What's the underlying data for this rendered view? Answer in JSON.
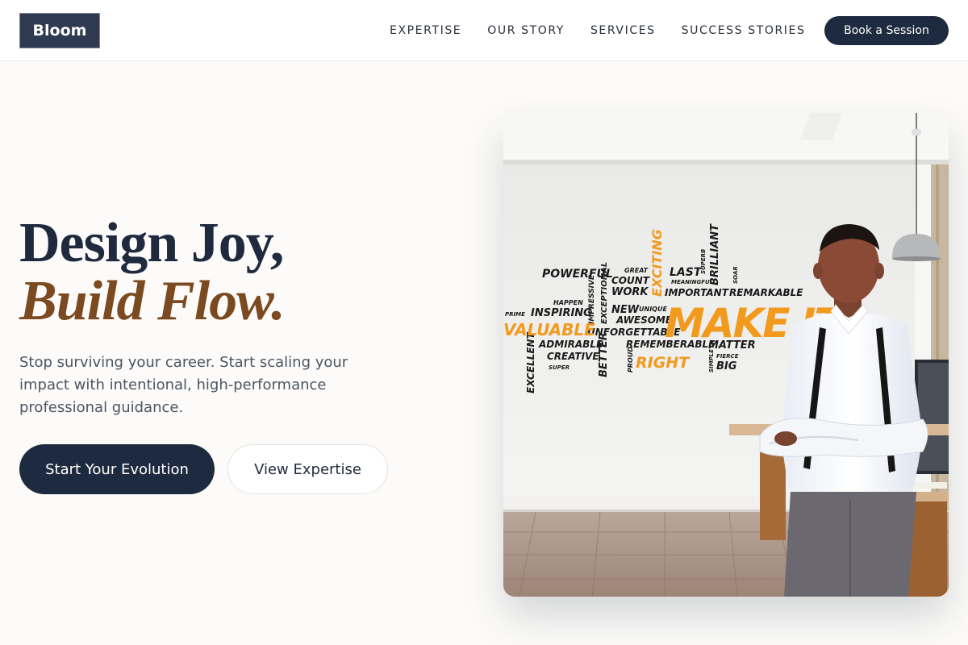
{
  "header": {
    "logo": "Bloom",
    "nav": [
      "EXPERTISE",
      "OUR STORY",
      "SERVICES",
      "SUCCESS STORIES"
    ],
    "cta": "Book a Session"
  },
  "hero": {
    "title_line1": "Design Joy,",
    "title_line2": "Build Flow.",
    "subtitle": "Stop surviving your career. Start scaling your impact with intentional, high-performance professional guidance.",
    "primary_button": "Start Your Evolution",
    "secondary_button": "View Expertise"
  },
  "image": {
    "words_dark": [
      "POWERFUL",
      "GREAT",
      "COUNT",
      "WORK",
      "LAST",
      "MEANINGFUL",
      "IMPORTANT",
      "REMARKABLE",
      "HAPPEN",
      "INSPIRING",
      "IMPRESSIVE",
      "EXCEPTIONAL",
      "NEW",
      "UNIQUE",
      "AWESOME",
      "PRIME",
      "UNFORGETTABLE",
      "ADMIRABLE",
      "CREATIVE",
      "SUPER",
      "EXCELLENT",
      "BETTER",
      "REMEMBERABLE",
      "PROUD",
      "MATTER",
      "SIMPLE",
      "FIERCE",
      "BIG",
      "BRILLIANT",
      "SUPERB",
      "SOAR"
    ],
    "words_orange": [
      "EXCITING",
      "MAKE IT",
      "VALUABLE",
      "RIGHT"
    ],
    "accent_color": "#f29a1e",
    "ink_color": "#1a1a1a"
  },
  "colors": {
    "navy": "#1e2a3f",
    "brown": "#7b4a20",
    "background": "#fcfbf9"
  }
}
